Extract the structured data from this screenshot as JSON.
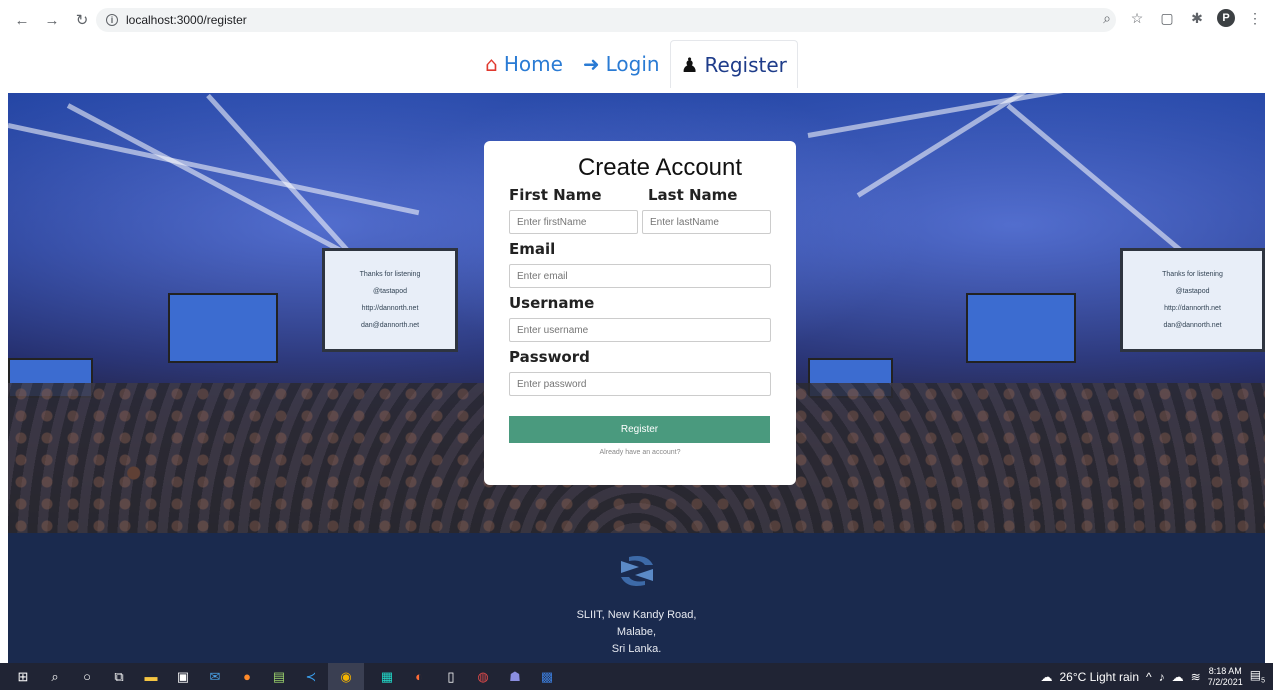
{
  "browser": {
    "url": "localhost:3000/register",
    "profile_initial": "P"
  },
  "nav": {
    "home": "Home",
    "login": "Login",
    "register": "Register"
  },
  "hero_screen": {
    "line1": "Thanks for listening",
    "line2": "@tastapod",
    "line3": "http://dannorth.net",
    "line4": "dan@dannorth.net"
  },
  "form": {
    "title": "Create Account",
    "first_name_label": "First Name",
    "first_name_placeholder": "Enter firstName",
    "last_name_label": "Last Name",
    "last_name_placeholder": "Enter lastName",
    "email_label": "Email",
    "email_placeholder": "Enter email",
    "username_label": "Username",
    "username_placeholder": "Enter username",
    "password_label": "Password",
    "password_placeholder": "Enter password",
    "submit_label": "Register",
    "login_link": "Already have an account?"
  },
  "footer": {
    "line1": "SLIIT, New Kandy Road,",
    "line2": "Malabe,",
    "line3": "Sri Lanka."
  },
  "taskbar": {
    "weather": "26°C  Light rain",
    "time": "8:18 AM",
    "date": "7/2/2021",
    "notifications": "5"
  }
}
